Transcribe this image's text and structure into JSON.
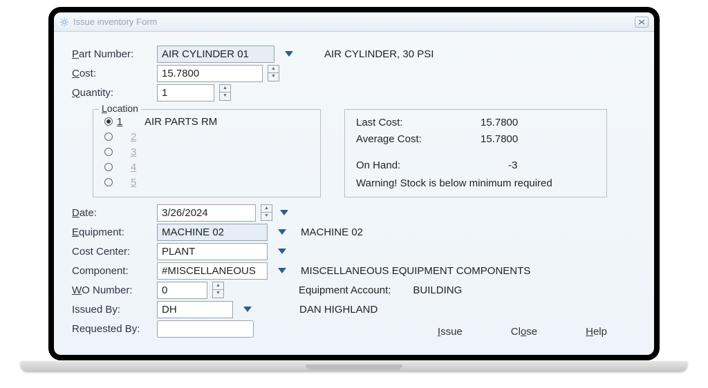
{
  "titlebar": {
    "title": "Issue inventory Form"
  },
  "part": {
    "label_pre": "P",
    "label_post": "art Number:",
    "value": "AIR CYLINDER 01",
    "desc": "AIR CYLINDER, 30 PSI"
  },
  "cost_field": {
    "label_pre": "C",
    "label_post": "ost:",
    "value": "15.7800"
  },
  "qty": {
    "label_pre": "Q",
    "label_post": "uantity:",
    "value": "1"
  },
  "location": {
    "label_pre": "L",
    "label_post": "ocation",
    "options": [
      "1",
      "2",
      "3",
      "4",
      "5"
    ],
    "selected_desc": "AIR PARTS RM"
  },
  "cost_panel": {
    "last_label": "Last Cost:",
    "last_value": "15.7800",
    "avg_label": "Average Cost:",
    "avg_value": "15.7800",
    "onhand_label": "On Hand:",
    "onhand_value": "-3",
    "warning": "Warning! Stock is below minimum required"
  },
  "date": {
    "label_pre": "D",
    "label_post": "ate:",
    "value": "3/26/2024"
  },
  "equipment": {
    "label_pre": "E",
    "label_post": "quipment:",
    "value": "MACHINE 02",
    "desc": "MACHINE 02"
  },
  "cost_center": {
    "label": "Cost Center:",
    "value": "PLANT"
  },
  "component": {
    "label": "Component:",
    "value": "#MISCELLANEOUS",
    "desc": "MISCELLANEOUS EQUIPMENT COMPONENTS"
  },
  "wo": {
    "label_pre": "W",
    "label_post": "O Number:",
    "value": "0",
    "eq_acct_label": "Equipment Account:",
    "eq_acct_value": "BUILDING"
  },
  "issued_by": {
    "label": "Issued By:",
    "value": "DH",
    "desc": "DAN HIGHLAND"
  },
  "requested_by": {
    "label": "Requested By:",
    "value": ""
  },
  "footer": {
    "issue_pre": "I",
    "issue_post": "ssue",
    "close_pre": "Cl",
    "close_post": "se",
    "close_u": "o",
    "help_pre": "",
    "help_u": "H",
    "help_post": "elp"
  }
}
